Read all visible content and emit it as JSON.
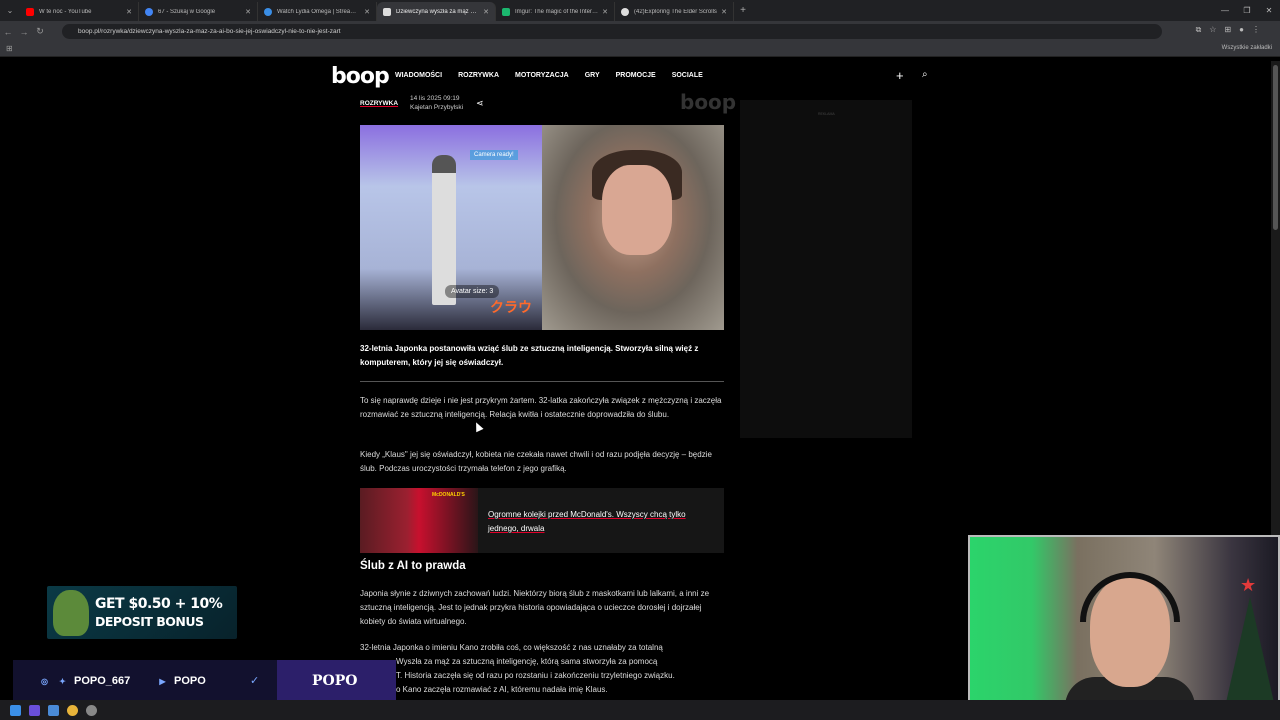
{
  "browser": {
    "tabs": [
      {
        "title": "W te noc - YouTube",
        "color": "#ff0000"
      },
      {
        "title": "67 - Szukaj w Google",
        "color": "#4285f4"
      },
      {
        "title": "Watch Lydia Omega | Streamab",
        "color": "#3a8ee6"
      },
      {
        "title": "Dziewczyna wyszła za mąż za A",
        "color": "#dddddd"
      },
      {
        "title": "Imgur: The magic of the Interne",
        "color": "#1bb76e"
      },
      {
        "title": "(42)Exploring The Elder Scrolls",
        "color": "#dddddd"
      }
    ],
    "active_tab": 3,
    "url": "boop.pl/rozrywka/dziewczyna-wyszla-za-maz-za-ai-bo-sie-jej-oswiadczyl-nie-to-nie-jest-zart",
    "bookmarks_label": "Wszystkie zakładki"
  },
  "site": {
    "logo": "boop",
    "menu": [
      "WIADOMOŚCI",
      "ROZRYWKA",
      "MOTORYZACJA",
      "GRY",
      "PROMOCJE",
      "SOCIALE"
    ],
    "accent": "#e0002a"
  },
  "article": {
    "category": "ROZRYWKA",
    "date": "14 lis 2025 09:19",
    "author": "Kajetan Przybylski",
    "watermark": "boop",
    "hero_caption_left": "Avatar size: 3",
    "hero_badge": "Camera ready!",
    "hero_jp": "クラウ",
    "lead": "32-letnia Japonka postanowiła wziąć ślub ze sztuczną inteligencją. Stworzyła silną więź z komputerem, który jej się oświadczył.",
    "p1": "To się naprawdę dzieje i nie jest przykrym żartem. 32-latka zakończyła związek z mężczyzną i zaczęła rozmawiać ze sztuczną inteligencją. Relacja kwitła i ostatecznie doprowadziła do ślubu.",
    "p2": "Kiedy „Klaus\" jej się oświadczył, kobieta nie czekała nawet chwili i od razu podjęła decyzję – będzie ślub. Podczas uroczystości trzymała telefon z jego grafiką.",
    "related_title": "Ogromne kolejki przed McDonald's. Wszyscy chcą tylko jednego, drwala",
    "related_img_text": "McDONALD'S",
    "h2": "Ślub z AI to prawda",
    "p3": "Japonia słynie z dziwnych zachowań ludzi. Niektórzy biorą ślub z maskotkami lub lalkami, a inni ze sztuczną inteligencją. Jest to jednak przykra historia opowiadająca o ucieczce dorosłej i dojrzałej kobiety do świata wirtualnego.",
    "p4_line1": "32-letnia Japonka o imieniu Kano zrobiła coś, co większość z nas uznałaby za totalną",
    "p4_line2": "Wyszła za mąż za sztuczną inteligencję, którą sama stworzyła za pomocą",
    "p4_line3": "T. Historia zaczęła się od razu po rozstaniu i zakończeniu trzyletniego związku.",
    "p4_line4": "o Kano zaczęła rozmawiać z AI, któremu nadała imię Klaus."
  },
  "sidebar_ad_label": "REKLAMA",
  "overlay": {
    "promo_line1": "GET $0.50 + 10%",
    "promo_line2": "DEPOSIT BONUS",
    "twitter": "POPO_667",
    "youtube": "POPO",
    "brand": "POPO"
  }
}
